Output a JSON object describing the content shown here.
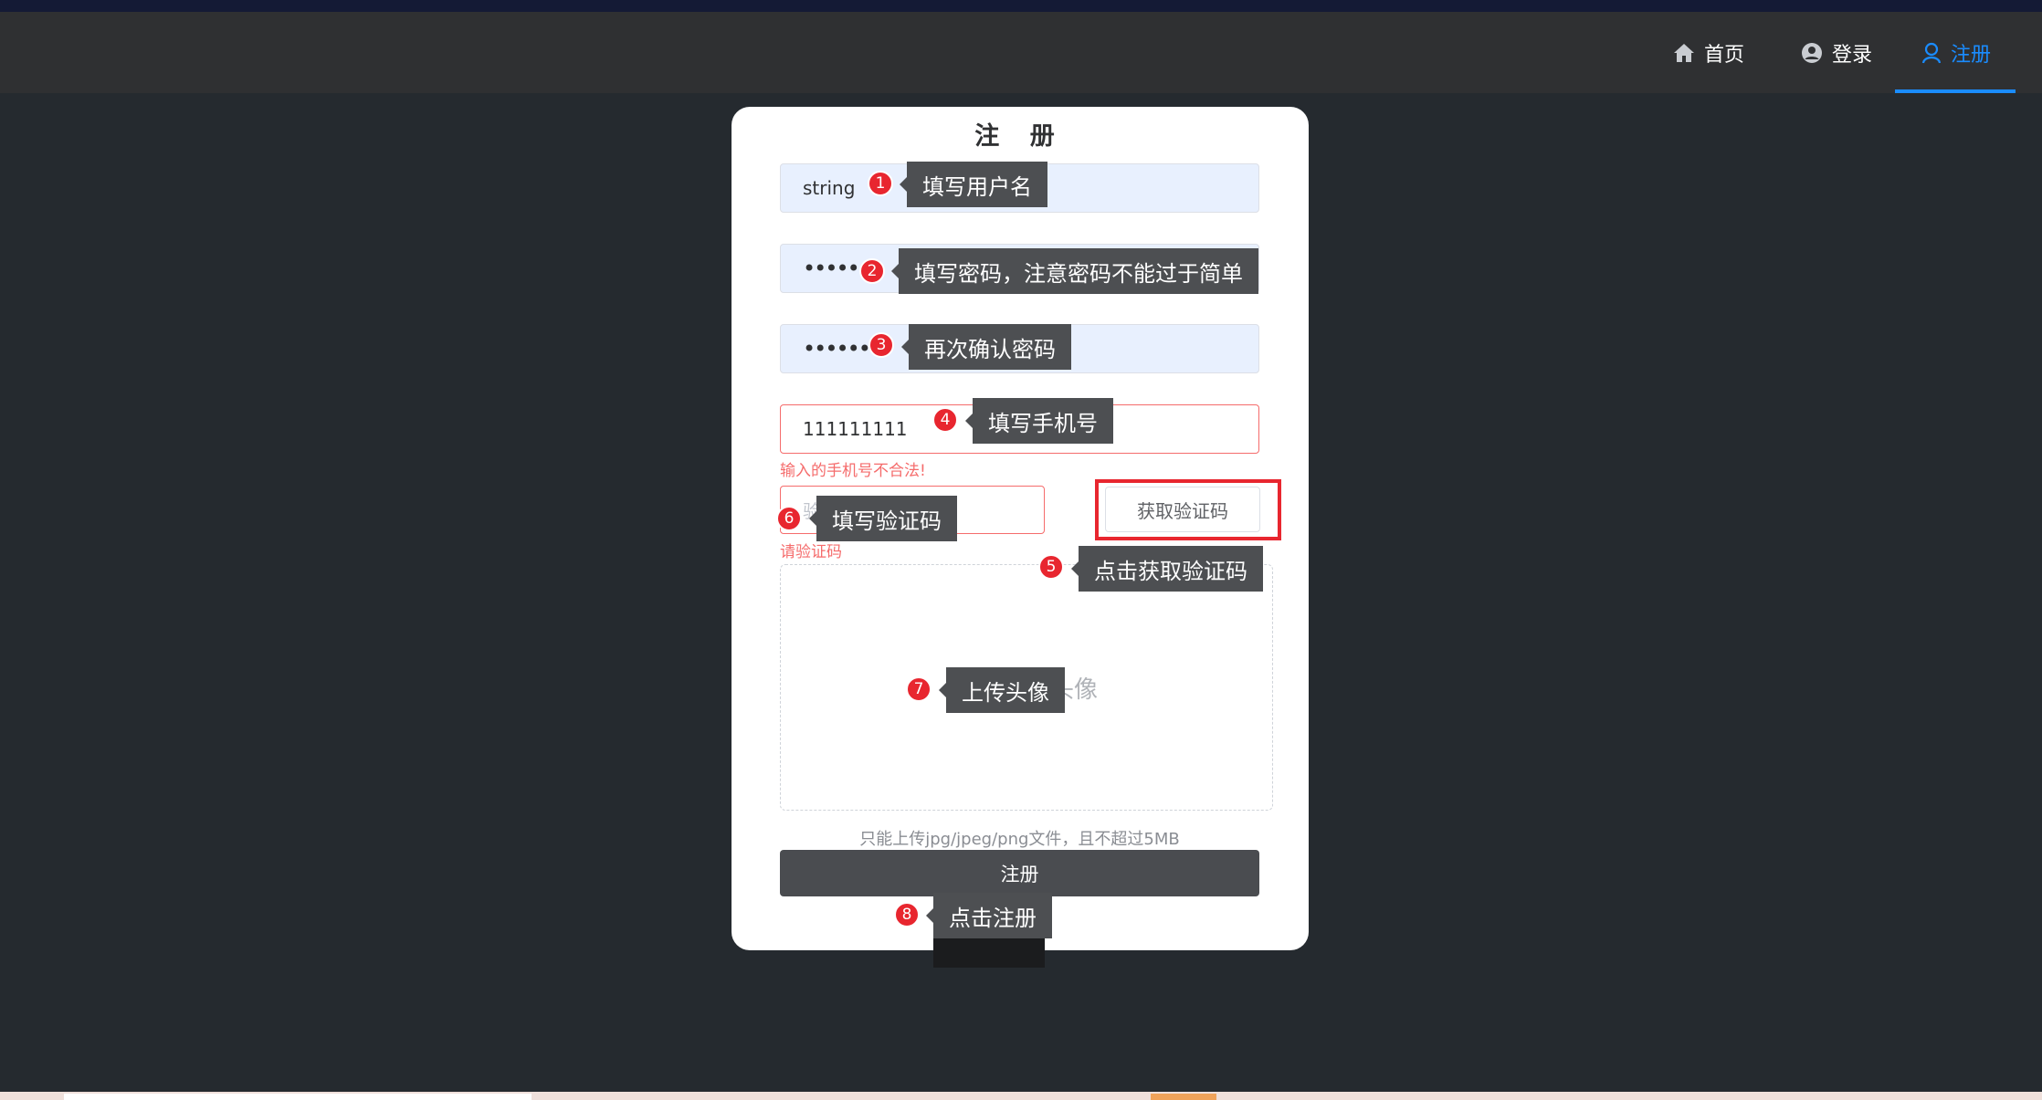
{
  "nav": {
    "home": "首页",
    "login": "登录",
    "register": "注册",
    "accent": "#1a8cff"
  },
  "form": {
    "title": "注 册",
    "username_value": "string",
    "password_value": "••••••",
    "confirm_value": "••••••",
    "phone_value": "111111111",
    "phone_error": "输入的手机号不合法!",
    "code_placeholder": "验证码",
    "code_error": "请验证码",
    "get_code_label": "获取验证码",
    "upload_label": "上传个人头像",
    "upload_tip": "只能上传jpg/jpeg/png文件，且不超过5MB",
    "submit_label": "注册"
  },
  "annotations": [
    {
      "num": "1",
      "text": "填写用户名"
    },
    {
      "num": "2",
      "text": "填写密码，注意密码不能过于简单"
    },
    {
      "num": "3",
      "text": "再次确认密码"
    },
    {
      "num": "4",
      "text": "填写手机号"
    },
    {
      "num": "5",
      "text": "点击获取验证码"
    },
    {
      "num": "6",
      "text": "填写验证码"
    },
    {
      "num": "7",
      "text": "上传头像"
    },
    {
      "num": "8",
      "text": "点击注册"
    }
  ],
  "colors": {
    "page_bg": "#252a2f",
    "navbar_bg": "#2f3032",
    "error": "#f56c6c",
    "highlight": "#e8262f",
    "callout_bg": "#4d4f52"
  }
}
